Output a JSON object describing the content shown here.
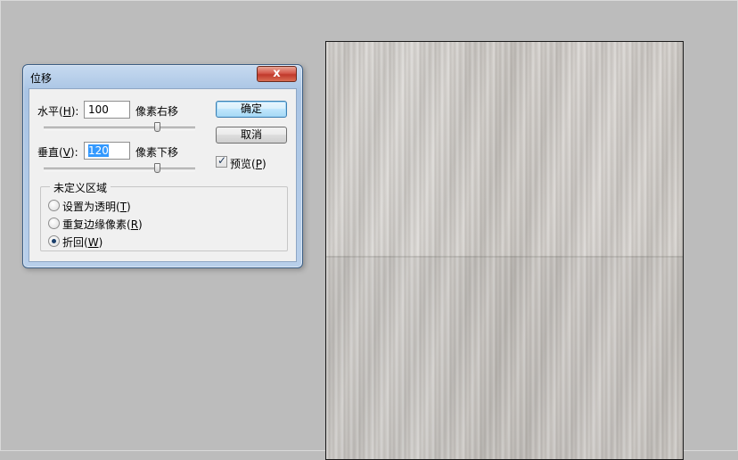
{
  "dialog": {
    "title": "位移",
    "close_label": "x",
    "horizontal": {
      "label_prefix": "水平(",
      "mnemonic": "H",
      "label_suffix": "):",
      "value": "100",
      "unit": "像素右移",
      "slider_fraction": 0.75
    },
    "vertical": {
      "label_prefix": "垂直(",
      "mnemonic": "V",
      "label_suffix": "):",
      "value": "120",
      "unit": "像素下移",
      "slider_fraction": 0.75
    },
    "ok_label": "确定",
    "cancel_label": "取消",
    "preview": {
      "label_prefix": "预览(",
      "mnemonic": "P",
      "label_suffix": ")",
      "checked": true
    },
    "undefined_area": {
      "legend": "未定义区域",
      "options": [
        {
          "label_prefix": "设置为透明(",
          "mnemonic": "T",
          "label_suffix": ")",
          "selected": false
        },
        {
          "label_prefix": "重复边缘像素(",
          "mnemonic": "R",
          "label_suffix": ")",
          "selected": false
        },
        {
          "label_prefix": "折回(",
          "mnemonic": "W",
          "label_suffix": ")",
          "selected": true
        }
      ]
    }
  }
}
